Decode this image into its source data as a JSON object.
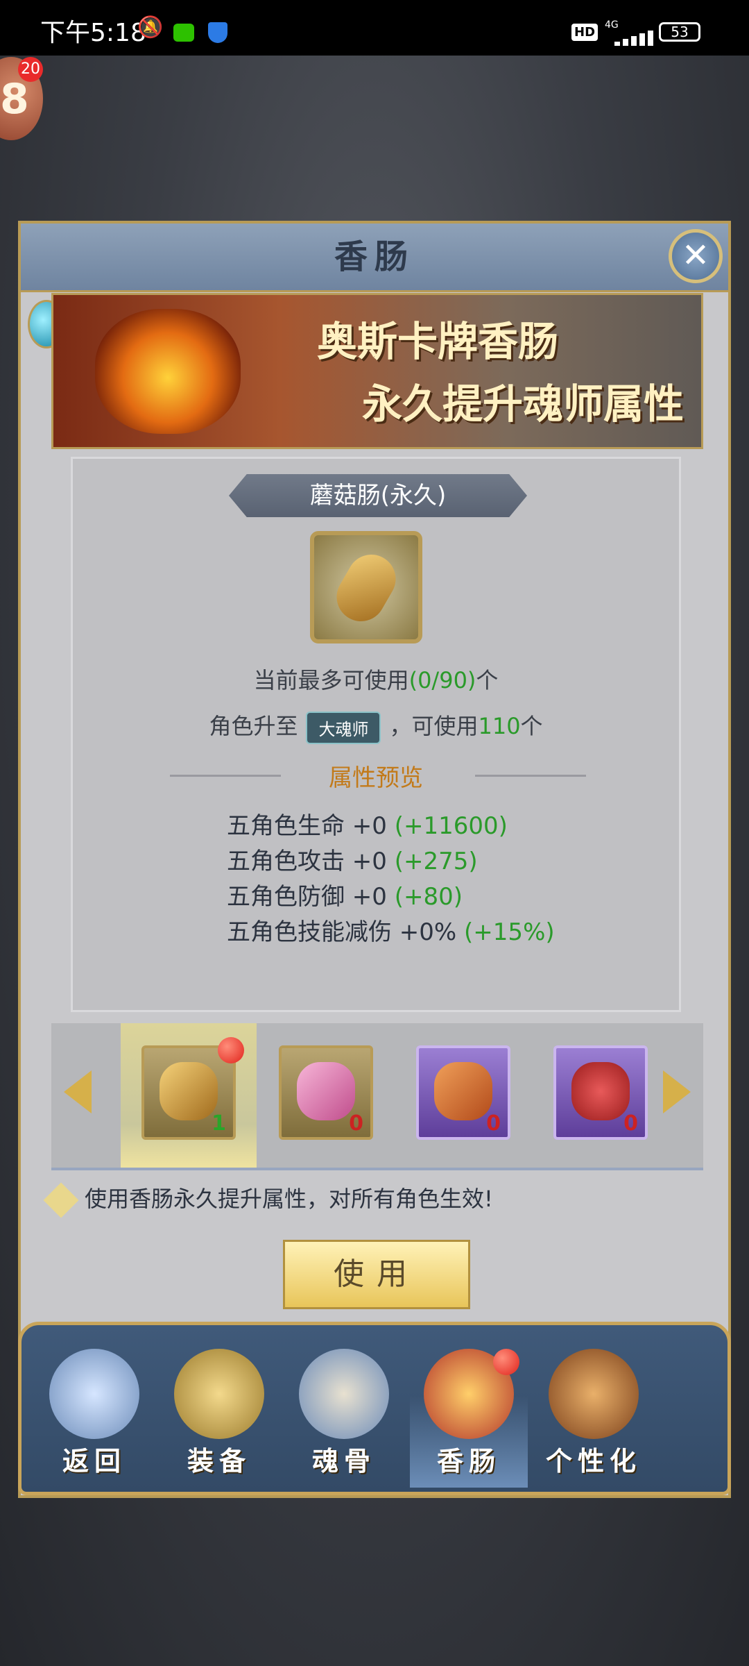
{
  "status_bar": {
    "time": "下午5:18",
    "network": "4G",
    "battery": "53",
    "hd": "HD"
  },
  "float_badge": {
    "count": "20",
    "glyph": "8"
  },
  "panel": {
    "title": "香肠",
    "banner_line1": "奥斯卡牌香肠",
    "banner_line2": "永久提升魂师属性",
    "item_name": "蘑菇肠(永久)",
    "usage_prefix": "当前最多可使用",
    "usage_value": "(0/90)",
    "usage_suffix": "个",
    "upgrade_prefix": "角色升至",
    "upgrade_rank": "大魂师",
    "upgrade_middle": "，可使用",
    "upgrade_value": "110",
    "upgrade_suffix": "个",
    "preview_title": "属性预览",
    "stats": [
      {
        "label": "五角色生命 +0 ",
        "bonus": "(+11600)"
      },
      {
        "label": "五角色攻击 +0 ",
        "bonus": "(+275)"
      },
      {
        "label": "五角色防御 +0 ",
        "bonus": "(+80)"
      },
      {
        "label": "五角色技能减伤 +0% ",
        "bonus": "(+15%)"
      }
    ],
    "items": [
      {
        "count": "1"
      },
      {
        "count": "0"
      },
      {
        "count": "0"
      },
      {
        "count": "0"
      }
    ],
    "hint": "使用香肠永久提升属性，对所有角色生效!",
    "use_label": "使用"
  },
  "bottom_nav": {
    "back": "返回",
    "equip": "装备",
    "soul_bone": "魂骨",
    "sausage": "香肠",
    "personalize": "个性化"
  },
  "colors": {
    "accent_gold": "#b89b56",
    "bonus_green": "#2a9a2a",
    "preview_orange": "#c27a1a"
  }
}
